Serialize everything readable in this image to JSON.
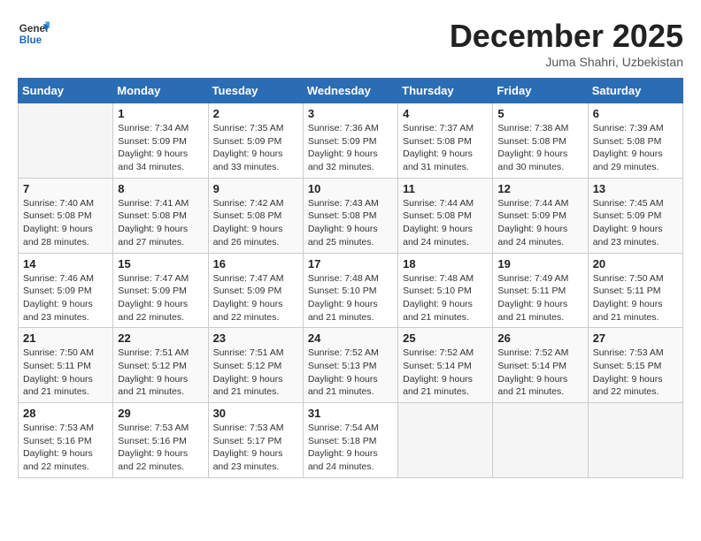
{
  "header": {
    "logo_line1": "General",
    "logo_line2": "Blue",
    "month": "December 2025",
    "location": "Juma Shahri, Uzbekistan"
  },
  "weekdays": [
    "Sunday",
    "Monday",
    "Tuesday",
    "Wednesday",
    "Thursday",
    "Friday",
    "Saturday"
  ],
  "weeks": [
    [
      {
        "day": "",
        "info": ""
      },
      {
        "day": "1",
        "info": "Sunrise: 7:34 AM\nSunset: 5:09 PM\nDaylight: 9 hours\nand 34 minutes."
      },
      {
        "day": "2",
        "info": "Sunrise: 7:35 AM\nSunset: 5:09 PM\nDaylight: 9 hours\nand 33 minutes."
      },
      {
        "day": "3",
        "info": "Sunrise: 7:36 AM\nSunset: 5:09 PM\nDaylight: 9 hours\nand 32 minutes."
      },
      {
        "day": "4",
        "info": "Sunrise: 7:37 AM\nSunset: 5:08 PM\nDaylight: 9 hours\nand 31 minutes."
      },
      {
        "day": "5",
        "info": "Sunrise: 7:38 AM\nSunset: 5:08 PM\nDaylight: 9 hours\nand 30 minutes."
      },
      {
        "day": "6",
        "info": "Sunrise: 7:39 AM\nSunset: 5:08 PM\nDaylight: 9 hours\nand 29 minutes."
      }
    ],
    [
      {
        "day": "7",
        "info": "Sunrise: 7:40 AM\nSunset: 5:08 PM\nDaylight: 9 hours\nand 28 minutes."
      },
      {
        "day": "8",
        "info": "Sunrise: 7:41 AM\nSunset: 5:08 PM\nDaylight: 9 hours\nand 27 minutes."
      },
      {
        "day": "9",
        "info": "Sunrise: 7:42 AM\nSunset: 5:08 PM\nDaylight: 9 hours\nand 26 minutes."
      },
      {
        "day": "10",
        "info": "Sunrise: 7:43 AM\nSunset: 5:08 PM\nDaylight: 9 hours\nand 25 minutes."
      },
      {
        "day": "11",
        "info": "Sunrise: 7:44 AM\nSunset: 5:08 PM\nDaylight: 9 hours\nand 24 minutes."
      },
      {
        "day": "12",
        "info": "Sunrise: 7:44 AM\nSunset: 5:09 PM\nDaylight: 9 hours\nand 24 minutes."
      },
      {
        "day": "13",
        "info": "Sunrise: 7:45 AM\nSunset: 5:09 PM\nDaylight: 9 hours\nand 23 minutes."
      }
    ],
    [
      {
        "day": "14",
        "info": "Sunrise: 7:46 AM\nSunset: 5:09 PM\nDaylight: 9 hours\nand 23 minutes."
      },
      {
        "day": "15",
        "info": "Sunrise: 7:47 AM\nSunset: 5:09 PM\nDaylight: 9 hours\nand 22 minutes."
      },
      {
        "day": "16",
        "info": "Sunrise: 7:47 AM\nSunset: 5:09 PM\nDaylight: 9 hours\nand 22 minutes."
      },
      {
        "day": "17",
        "info": "Sunrise: 7:48 AM\nSunset: 5:10 PM\nDaylight: 9 hours\nand 21 minutes."
      },
      {
        "day": "18",
        "info": "Sunrise: 7:48 AM\nSunset: 5:10 PM\nDaylight: 9 hours\nand 21 minutes."
      },
      {
        "day": "19",
        "info": "Sunrise: 7:49 AM\nSunset: 5:11 PM\nDaylight: 9 hours\nand 21 minutes."
      },
      {
        "day": "20",
        "info": "Sunrise: 7:50 AM\nSunset: 5:11 PM\nDaylight: 9 hours\nand 21 minutes."
      }
    ],
    [
      {
        "day": "21",
        "info": "Sunrise: 7:50 AM\nSunset: 5:11 PM\nDaylight: 9 hours\nand 21 minutes."
      },
      {
        "day": "22",
        "info": "Sunrise: 7:51 AM\nSunset: 5:12 PM\nDaylight: 9 hours\nand 21 minutes."
      },
      {
        "day": "23",
        "info": "Sunrise: 7:51 AM\nSunset: 5:12 PM\nDaylight: 9 hours\nand 21 minutes."
      },
      {
        "day": "24",
        "info": "Sunrise: 7:52 AM\nSunset: 5:13 PM\nDaylight: 9 hours\nand 21 minutes."
      },
      {
        "day": "25",
        "info": "Sunrise: 7:52 AM\nSunset: 5:14 PM\nDaylight: 9 hours\nand 21 minutes."
      },
      {
        "day": "26",
        "info": "Sunrise: 7:52 AM\nSunset: 5:14 PM\nDaylight: 9 hours\nand 21 minutes."
      },
      {
        "day": "27",
        "info": "Sunrise: 7:53 AM\nSunset: 5:15 PM\nDaylight: 9 hours\nand 22 minutes."
      }
    ],
    [
      {
        "day": "28",
        "info": "Sunrise: 7:53 AM\nSunset: 5:16 PM\nDaylight: 9 hours\nand 22 minutes."
      },
      {
        "day": "29",
        "info": "Sunrise: 7:53 AM\nSunset: 5:16 PM\nDaylight: 9 hours\nand 22 minutes."
      },
      {
        "day": "30",
        "info": "Sunrise: 7:53 AM\nSunset: 5:17 PM\nDaylight: 9 hours\nand 23 minutes."
      },
      {
        "day": "31",
        "info": "Sunrise: 7:54 AM\nSunset: 5:18 PM\nDaylight: 9 hours\nand 24 minutes."
      },
      {
        "day": "",
        "info": ""
      },
      {
        "day": "",
        "info": ""
      },
      {
        "day": "",
        "info": ""
      }
    ]
  ]
}
